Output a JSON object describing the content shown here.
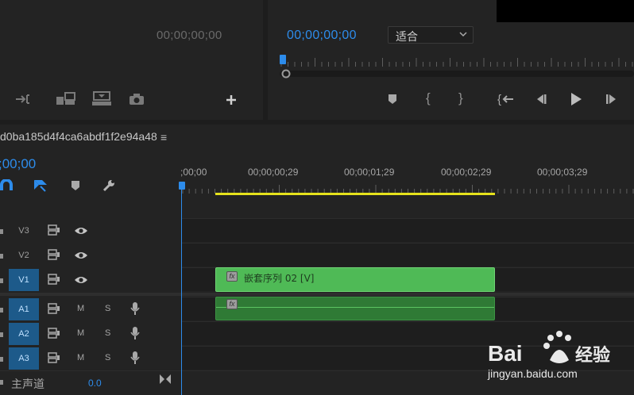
{
  "source_monitor": {
    "timecode": "00;00;00;00"
  },
  "program_monitor": {
    "timecode": "00;00;00;00",
    "fit_value": "适合"
  },
  "timeline": {
    "sequence_name": "d0ba185d4f4ca6abdf1f2e94a48",
    "menu_icon": "≡",
    "timecode": ";00;00",
    "ruler_labels": [
      ";00;00",
      "00;00;00;29",
      "00;00;01;29",
      "00;00;02;29",
      "00;00;03;29"
    ],
    "tracks": {
      "v3": "V3",
      "v2": "V2",
      "v1": "V1",
      "a1": "A1",
      "a2": "A2",
      "a3": "A3"
    },
    "mute": "M",
    "solo": "S",
    "clip_v1": {
      "fx": "fx",
      "label": "嵌套序列 02 [V]"
    },
    "clip_a1": {
      "fx": "fx"
    },
    "master": {
      "label": "主声道",
      "value": "0.0"
    }
  },
  "watermark": {
    "brand": "Bai",
    "brand2": "经验",
    "url": "jingyan.baidu.com"
  },
  "colors": {
    "accent": "#2d8ceb",
    "clip_video": "#4fba56",
    "clip_audio": "#2f7a35",
    "work_area": "#e5e21c"
  }
}
